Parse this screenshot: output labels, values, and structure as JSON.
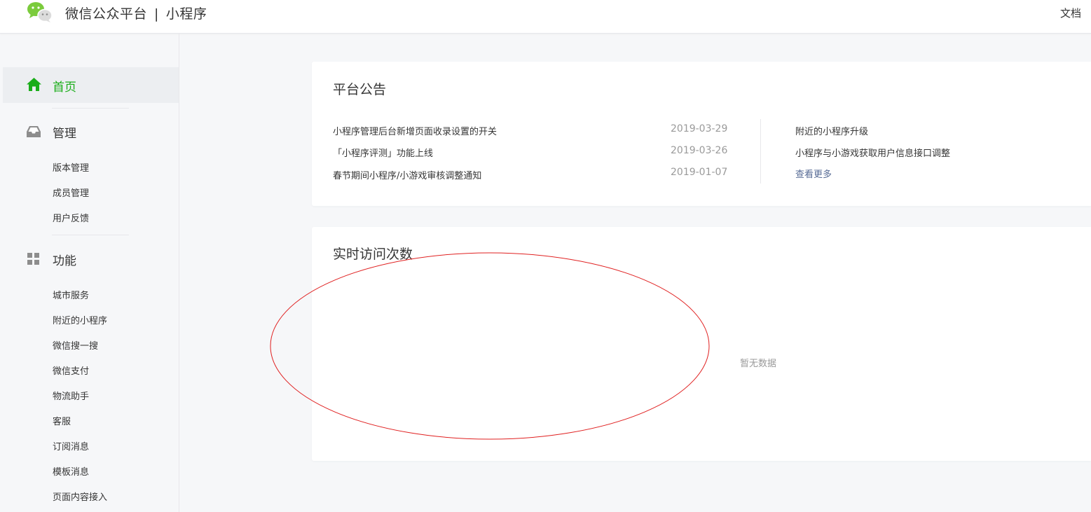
{
  "header": {
    "brand": "微信公众平台",
    "separator": "|",
    "product": "小程序",
    "doc_link": "文档",
    "brand_color": "#1aad19"
  },
  "sidebar": {
    "home": {
      "label": "首页",
      "icon": "home-icon",
      "active": true
    },
    "groups": [
      {
        "label": "管理",
        "icon": "inbox-icon",
        "items": [
          {
            "label": "版本管理"
          },
          {
            "label": "成员管理"
          },
          {
            "label": "用户反馈"
          }
        ]
      },
      {
        "label": "功能",
        "icon": "grid-icon",
        "items": [
          {
            "label": "城市服务"
          },
          {
            "label": "附近的小程序"
          },
          {
            "label": "微信搜一搜"
          },
          {
            "label": "微信支付"
          },
          {
            "label": "物流助手"
          },
          {
            "label": "客服"
          },
          {
            "label": "订阅消息"
          },
          {
            "label": "模板消息"
          },
          {
            "label": "页面内容接入"
          }
        ]
      }
    ]
  },
  "announcements": {
    "title": "平台公告",
    "items": [
      {
        "title": "小程序管理后台新增页面收录设置的开关",
        "date": "2019-03-29"
      },
      {
        "title": "「小程序评测」功能上线",
        "date": "2019-03-26"
      },
      {
        "title": "春节期间小程序/小游戏审核调整通知",
        "date": "2019-01-07"
      }
    ],
    "side_items": [
      {
        "title": "附近的小程序升级"
      },
      {
        "title": "小程序与小游戏获取用户信息接口调整"
      }
    ],
    "more_label": "查看更多"
  },
  "visits": {
    "title": "实时访问次数",
    "empty_text": "暂无数据"
  },
  "colors": {
    "accent": "#1aad19",
    "link": "#576b95",
    "muted": "#9a9a9a",
    "annotation": "#e02020"
  }
}
